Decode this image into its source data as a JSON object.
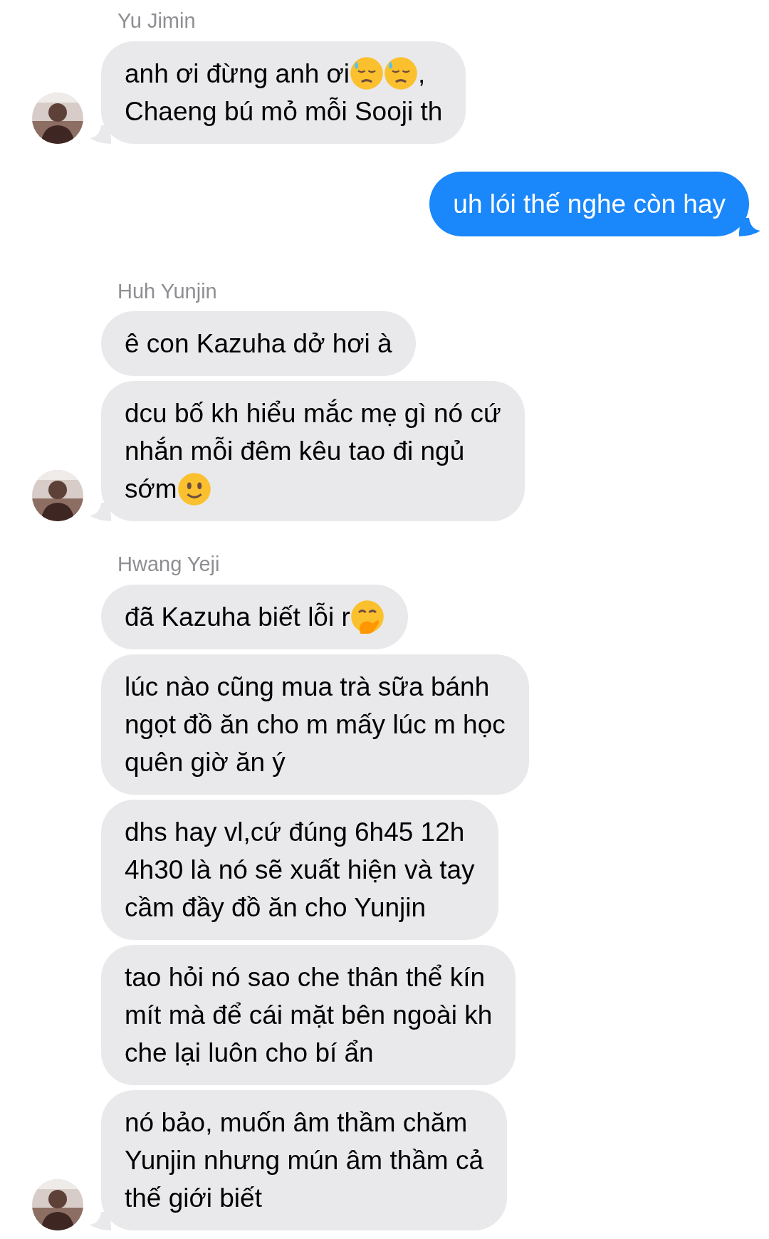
{
  "groups": [
    {
      "kind": "incoming",
      "sender": "Yu Jimin",
      "messages": [
        {
          "lines": [
            [
              {
                "kind": "text",
                "text": "anh ơi đừng anh ơi"
              },
              {
                "kind": "sweat-face"
              },
              {
                "kind": "sweat-face"
              },
              {
                "kind": "text",
                "text": ","
              }
            ],
            [
              {
                "kind": "text",
                "text": "Chaeng bú mỏ mỗi Sooji th"
              }
            ]
          ]
        }
      ]
    },
    {
      "kind": "outgoing",
      "messages": [
        {
          "lines": [
            [
              {
                "kind": "text",
                "text": "uh lói thế nghe còn hay"
              }
            ]
          ]
        }
      ]
    },
    {
      "kind": "incoming",
      "sender": "Huh Yunjin",
      "messages": [
        {
          "lines": [
            [
              {
                "kind": "text",
                "text": "ê con Kazuha dở hơi à"
              }
            ]
          ]
        },
        {
          "lines": [
            [
              {
                "kind": "text",
                "text": "dcu bố kh hiểu mắc mẹ gì nó cứ"
              }
            ],
            [
              {
                "kind": "text",
                "text": "nhắn mỗi đêm kêu tao đi ngủ"
              }
            ],
            [
              {
                "kind": "text",
                "text": "sớm"
              },
              {
                "kind": "smile-face"
              }
            ]
          ]
        }
      ]
    },
    {
      "kind": "incoming",
      "sender": "Hwang Yeji",
      "messages": [
        {
          "lines": [
            [
              {
                "kind": "text",
                "text": "đã Kazuha biết lỗi r"
              },
              {
                "kind": "hand-over-mouth-face"
              }
            ]
          ]
        },
        {
          "lines": [
            [
              {
                "kind": "text",
                "text": "lúc nào cũng mua trà sữa bánh"
              }
            ],
            [
              {
                "kind": "text",
                "text": "ngọt đồ ăn cho m mấy lúc m học"
              }
            ],
            [
              {
                "kind": "text",
                "text": "quên giờ ăn ý"
              }
            ]
          ]
        },
        {
          "lines": [
            [
              {
                "kind": "text",
                "text": "dhs hay vl,cứ đúng 6h45 12h"
              }
            ],
            [
              {
                "kind": "text",
                "text": "4h30 là nó sẽ xuất hiện và tay"
              }
            ],
            [
              {
                "kind": "text",
                "text": "cầm đầy đồ ăn cho Yunjin"
              }
            ]
          ]
        },
        {
          "lines": [
            [
              {
                "kind": "text",
                "text": "tao hỏi nó sao che thân thể kín"
              }
            ],
            [
              {
                "kind": "text",
                "text": "mít mà để cái mặt bên ngoài kh"
              }
            ],
            [
              {
                "kind": "text",
                "text": "che lại luôn cho bí ẩn"
              }
            ]
          ]
        },
        {
          "lines": [
            [
              {
                "kind": "text",
                "text": "nó bảo, muốn âm thầm chăm"
              }
            ],
            [
              {
                "kind": "text",
                "text": "Yunjin nhưng mún âm thầm cả"
              }
            ],
            [
              {
                "kind": "text",
                "text": "thế giới biết"
              }
            ]
          ]
        }
      ]
    }
  ]
}
